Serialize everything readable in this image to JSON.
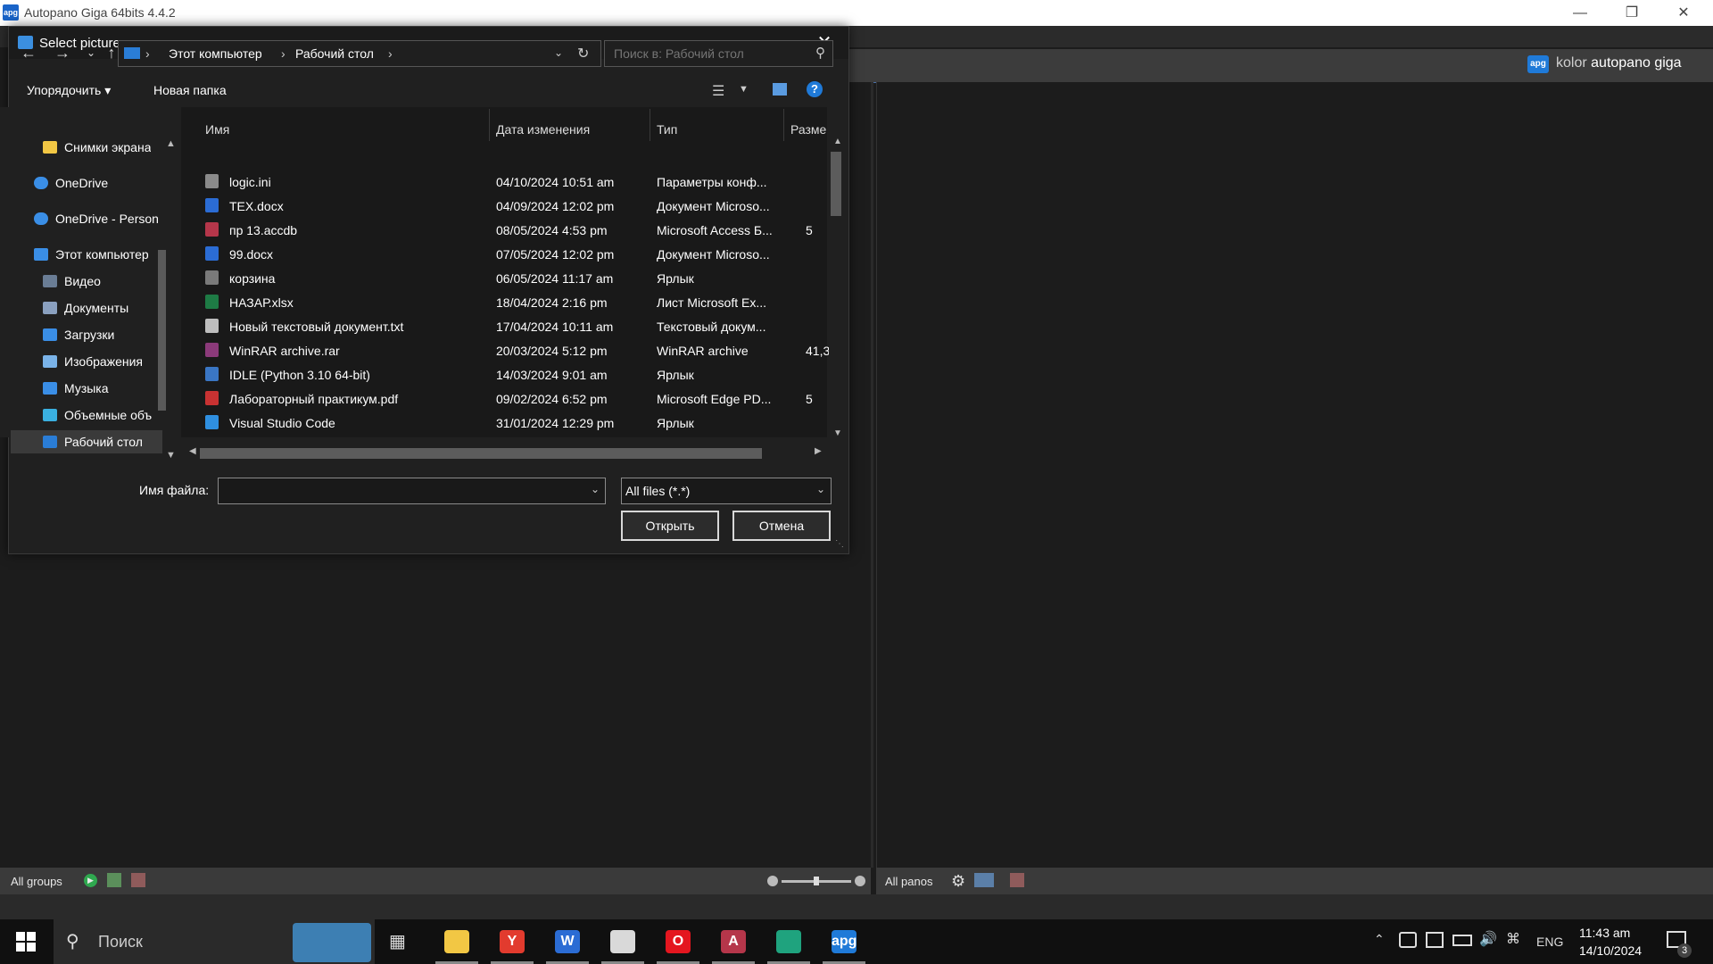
{
  "app": {
    "title": "Autopano Giga 64bits 4.4.2",
    "icon_text": "apg",
    "brand_prefix": "kolor",
    "brand_name": "autopano giga",
    "left_status": "All groups",
    "right_status": "All panos"
  },
  "dialog": {
    "title": "Select pictures",
    "breadcrumb": [
      "Этот компьютер",
      "Рабочий стол"
    ],
    "search_placeholder": "Поиск в: Рабочий стол",
    "toolbar": {
      "organize": "Упорядочить",
      "new_folder": "Новая папка"
    },
    "nav_items": [
      {
        "label": "Снимки экрана",
        "icon": "folder-icon"
      },
      {
        "label": "OneDrive",
        "icon": "cloud-icon"
      },
      {
        "label": "OneDrive - Person",
        "icon": "cloud-icon"
      },
      {
        "label": "Этот компьютер",
        "icon": "computer-icon"
      },
      {
        "label": "Видео",
        "icon": "video-icon"
      },
      {
        "label": "Документы",
        "icon": "documents-icon"
      },
      {
        "label": "Загрузки",
        "icon": "download-icon"
      },
      {
        "label": "Изображения",
        "icon": "pictures-icon"
      },
      {
        "label": "Музыка",
        "icon": "music-icon"
      },
      {
        "label": "Объемные объ",
        "icon": "3d-objects-icon"
      },
      {
        "label": "Рабочий стол",
        "icon": "desktop-icon"
      }
    ],
    "columns": {
      "name": "Имя",
      "date": "Дата изменения",
      "type": "Тип",
      "size": "Разме"
    },
    "files": [
      {
        "name": "logic.ini",
        "date": "04/10/2024 10:51 am",
        "type": "Параметры конф...",
        "size": "",
        "icon": "settings-file-icon",
        "color": "#8a8a8a"
      },
      {
        "name": "TEX.docx",
        "date": "04/09/2024 12:02 pm",
        "type": "Документ Microso...",
        "size": "",
        "icon": "word-file-icon",
        "color": "#2b6cd4"
      },
      {
        "name": "пр 13.accdb",
        "date": "08/05/2024 4:53 pm",
        "type": "Microsoft Access Б...",
        "size": "5",
        "icon": "access-file-icon",
        "color": "#b5364a"
      },
      {
        "name": "99.docx",
        "date": "07/05/2024 12:02 pm",
        "type": "Документ Microso...",
        "size": "",
        "icon": "word-file-icon",
        "color": "#2b6cd4"
      },
      {
        "name": "корзина",
        "date": "06/05/2024 11:17 am",
        "type": "Ярлык",
        "size": "",
        "icon": "shortcut-icon",
        "color": "#7a7a7a"
      },
      {
        "name": "НАЗАР.xlsx",
        "date": "18/04/2024 2:16 pm",
        "type": "Лист Microsoft Ex...",
        "size": "",
        "icon": "excel-file-icon",
        "color": "#1e7b45"
      },
      {
        "name": "Новый текстовый документ.txt",
        "date": "17/04/2024 10:11 am",
        "type": "Текстовый докум...",
        "size": "",
        "icon": "text-file-icon",
        "color": "#bdbdbd"
      },
      {
        "name": "WinRAR archive.rar",
        "date": "20/03/2024 5:12 pm",
        "type": "WinRAR archive",
        "size": "41,3",
        "icon": "archive-icon",
        "color": "#8b3a7a"
      },
      {
        "name": "IDLE (Python 3.10 64-bit)",
        "date": "14/03/2024 9:01 am",
        "type": "Ярлык",
        "size": "",
        "icon": "python-icon",
        "color": "#3a76c4"
      },
      {
        "name": "Лабораторный практикум.pdf",
        "date": "09/02/2024 6:52 pm",
        "type": "Microsoft Edge PD...",
        "size": "5",
        "icon": "pdf-file-icon",
        "color": "#c83232"
      },
      {
        "name": "Visual Studio Code",
        "date": "31/01/2024 12:29 pm",
        "type": "Ярлык",
        "size": "",
        "icon": "vscode-icon",
        "color": "#2f8fe0"
      }
    ],
    "filename_label": "Имя файла:",
    "filename_value": "",
    "filter_value": "All files (*.*)",
    "open_button": "Открыть",
    "cancel_button": "Отмена"
  },
  "taskbar": {
    "search_placeholder": "Поиск",
    "language": "ENG",
    "time": "11:43 am",
    "date": "14/10/2024",
    "notification_count": "3",
    "apps": [
      {
        "name": "file-explorer",
        "glyph": "",
        "color": "#f2c744"
      },
      {
        "name": "yandex-browser",
        "glyph": "Y",
        "color": "#e23b2e"
      },
      {
        "name": "word",
        "glyph": "W",
        "color": "#2b6cd4"
      },
      {
        "name": "paint",
        "glyph": "",
        "color": "#d9d9d9"
      },
      {
        "name": "opera",
        "glyph": "O",
        "color": "#e4161f"
      },
      {
        "name": "access",
        "glyph": "A",
        "color": "#b5364a"
      },
      {
        "name": "edge",
        "glyph": "",
        "color": "#1fa37e"
      },
      {
        "name": "autopano",
        "glyph": "apg",
        "color": "#1f7ad8"
      }
    ]
  }
}
